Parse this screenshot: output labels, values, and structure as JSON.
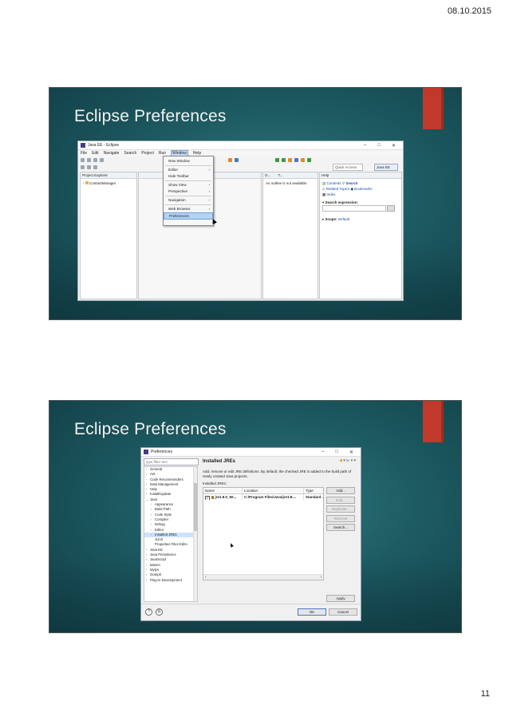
{
  "page": {
    "date": "08.10.2015",
    "number": "11"
  },
  "slides": [
    {
      "title": "Eclipse Preferences",
      "window": {
        "title": "Java EE - Eclipse",
        "menu": [
          "File",
          "Edit",
          "Navigate",
          "Search",
          "Project",
          "Run",
          "Window",
          "Help"
        ],
        "active_menu": "Window",
        "quick_access": "Quick Access",
        "perspective": "Java EE",
        "project_explorer": {
          "tab": "Project Explorer",
          "item": "ContactManager"
        },
        "outline": {
          "tab": "O...",
          "tab2": "T...",
          "text": "An outline is not available."
        },
        "help": {
          "tab": "Help",
          "contents": "Contents",
          "search": "Search",
          "related_topics": "Related Topics",
          "bookmarks": "Bookmarks",
          "index": "Index",
          "search_expression": "Search expression:",
          "scope": "Scope:",
          "scope_value": "Default"
        },
        "window_menu_items": [
          {
            "label": "New Window",
            "sub": false
          },
          {
            "label": "Editor",
            "sub": true
          },
          {
            "label": "Hide Toolbar",
            "sub": false
          },
          {
            "label": "Show View",
            "sub": true
          },
          {
            "label": "Perspective",
            "sub": true
          },
          {
            "label": "Navigation",
            "sub": true
          },
          {
            "label": "Web Browser",
            "sub": true
          },
          {
            "label": "Preferences",
            "sub": false,
            "highlighted": true
          }
        ]
      }
    },
    {
      "title": "Eclipse Preferences",
      "dialog": {
        "title": "Preferences",
        "filter_placeholder": "type filter text",
        "tree": [
          {
            "label": "General",
            "level": 0,
            "twisty": ">"
          },
          {
            "label": "Ant",
            "level": 0,
            "twisty": ">"
          },
          {
            "label": "Code Recommenders",
            "level": 0,
            "twisty": ">"
          },
          {
            "label": "Data Management",
            "level": 0,
            "twisty": ">"
          },
          {
            "label": "Help",
            "level": 0,
            "twisty": ">"
          },
          {
            "label": "Install/Update",
            "level": 0,
            "twisty": ">"
          },
          {
            "label": "Java",
            "level": 0,
            "twisty": "v"
          },
          {
            "label": "Appearance",
            "level": 1,
            "twisty": ">"
          },
          {
            "label": "Build Path",
            "level": 1,
            "twisty": ">"
          },
          {
            "label": "Code Style",
            "level": 1,
            "twisty": ">"
          },
          {
            "label": "Compiler",
            "level": 1,
            "twisty": ">"
          },
          {
            "label": "Debug",
            "level": 1,
            "twisty": ">"
          },
          {
            "label": "Editor",
            "level": 1,
            "twisty": ">"
          },
          {
            "label": "Installed JREs",
            "level": 1,
            "twisty": ">",
            "selected": true
          },
          {
            "label": "JUnit",
            "level": 1,
            "twisty": ""
          },
          {
            "label": "Properties Files Edito",
            "level": 1,
            "twisty": ""
          },
          {
            "label": "Java EE",
            "level": 0,
            "twisty": ">"
          },
          {
            "label": "Java Persistence",
            "level": 0,
            "twisty": ">"
          },
          {
            "label": "JavaScript",
            "level": 0,
            "twisty": ">"
          },
          {
            "label": "Maven",
            "level": 0,
            "twisty": ">"
          },
          {
            "label": "Mylyn",
            "level": 0,
            "twisty": ">"
          },
          {
            "label": "Oomph",
            "level": 0,
            "twisty": ">"
          },
          {
            "label": "Plug-in Development",
            "level": 0,
            "twisty": ">"
          }
        ],
        "page_title": "Installed JREs",
        "description": "Add, remove or edit JRE definitions. By default, the checked JRE is added to the build path of newly created Java projects.",
        "table_label": "Installed JREs:",
        "columns": [
          "Name",
          "Location",
          "Type"
        ],
        "rows": [
          {
            "name": "jre1.8.0_60...",
            "location": "C:\\Program Files\\Java\\jre1.8....",
            "type": "Standard ..."
          }
        ],
        "buttons": [
          {
            "label": "Add...",
            "disabled": false
          },
          {
            "label": "Edit...",
            "disabled": true
          },
          {
            "label": "Duplicate...",
            "disabled": true
          },
          {
            "label": "Remove",
            "disabled": true
          },
          {
            "label": "Search...",
            "disabled": false
          }
        ],
        "apply": "Apply",
        "ok": "OK",
        "cancel": "Cancel"
      }
    }
  ]
}
